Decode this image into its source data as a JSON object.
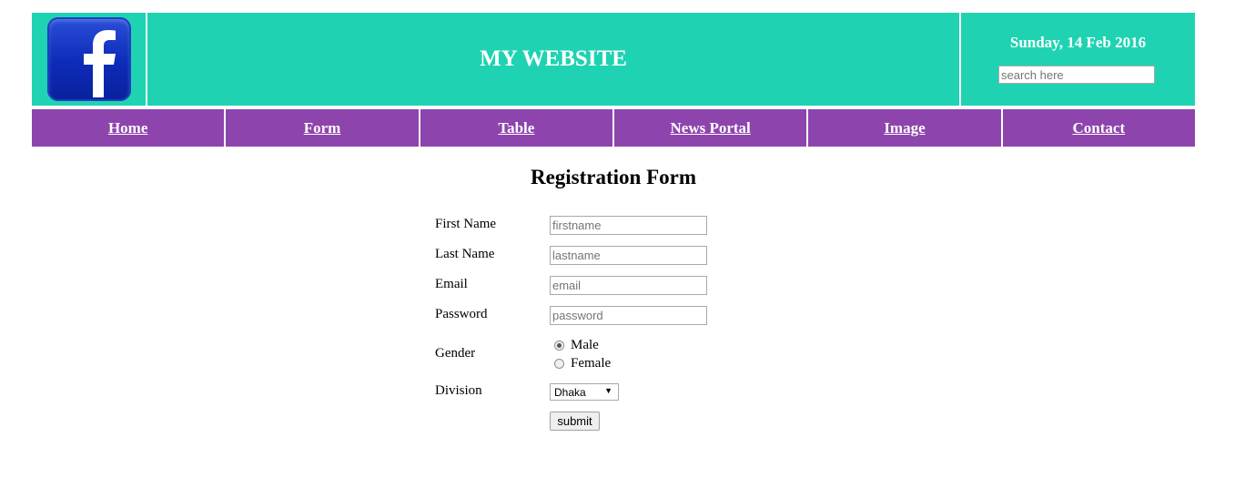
{
  "header": {
    "site_title": "MY WEBSITE",
    "date": "Sunday, 14 Feb 2016",
    "search_placeholder": "search here",
    "logo_icon": "facebook-logo",
    "logo_letter": "f"
  },
  "nav": {
    "items": [
      {
        "label": "Home"
      },
      {
        "label": "Form"
      },
      {
        "label": "Table"
      },
      {
        "label": "News Portal"
      },
      {
        "label": "Image"
      },
      {
        "label": "Contact"
      }
    ]
  },
  "form": {
    "title": "Registration Form",
    "first_name": {
      "label": "First Name",
      "placeholder": "firstname"
    },
    "last_name": {
      "label": "Last Name",
      "placeholder": "lastname"
    },
    "email": {
      "label": "Email",
      "placeholder": "email"
    },
    "password": {
      "label": "Password",
      "placeholder": "password"
    },
    "gender": {
      "label": "Gender",
      "options": [
        {
          "label": "Male",
          "checked": true
        },
        {
          "label": "Female",
          "checked": false
        }
      ]
    },
    "division": {
      "label": "Division",
      "selected": "Dhaka"
    },
    "submit_label": "submit"
  },
  "colors": {
    "header_bg": "#1fd3b2",
    "nav_bg": "#8e44ad"
  }
}
